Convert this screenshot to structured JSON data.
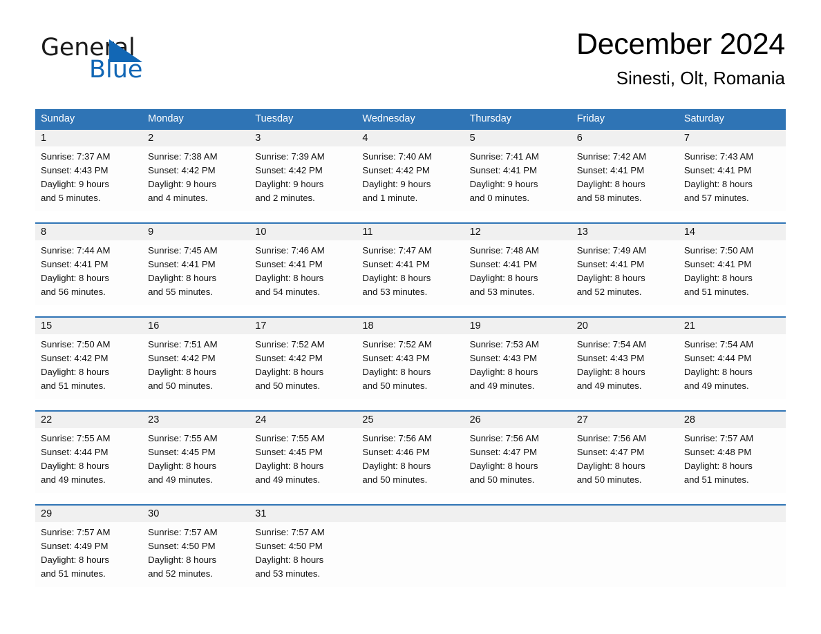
{
  "brand": {
    "name_part1": "General",
    "name_part2": "Blue",
    "triangle_icon": "blue-triangle-logo-icon",
    "accent_color": "#1267b5"
  },
  "header": {
    "month_title": "December 2024",
    "location": "Sinesti, Olt, Romania"
  },
  "calendar": {
    "header_bg_color": "#2f74b5",
    "row_divider_color": "#2f74b5",
    "daynum_band_color": "#f0f0f0",
    "weekday_headers": [
      "Sunday",
      "Monday",
      "Tuesday",
      "Wednesday",
      "Thursday",
      "Friday",
      "Saturday"
    ],
    "weeks": [
      [
        {
          "day": "1",
          "sunrise": "Sunrise: 7:37 AM",
          "sunset": "Sunset: 4:43 PM",
          "daylight_line1": "Daylight: 9 hours",
          "daylight_line2": "and 5 minutes."
        },
        {
          "day": "2",
          "sunrise": "Sunrise: 7:38 AM",
          "sunset": "Sunset: 4:42 PM",
          "daylight_line1": "Daylight: 9 hours",
          "daylight_line2": "and 4 minutes."
        },
        {
          "day": "3",
          "sunrise": "Sunrise: 7:39 AM",
          "sunset": "Sunset: 4:42 PM",
          "daylight_line1": "Daylight: 9 hours",
          "daylight_line2": "and 2 minutes."
        },
        {
          "day": "4",
          "sunrise": "Sunrise: 7:40 AM",
          "sunset": "Sunset: 4:42 PM",
          "daylight_line1": "Daylight: 9 hours",
          "daylight_line2": "and 1 minute."
        },
        {
          "day": "5",
          "sunrise": "Sunrise: 7:41 AM",
          "sunset": "Sunset: 4:41 PM",
          "daylight_line1": "Daylight: 9 hours",
          "daylight_line2": "and 0 minutes."
        },
        {
          "day": "6",
          "sunrise": "Sunrise: 7:42 AM",
          "sunset": "Sunset: 4:41 PM",
          "daylight_line1": "Daylight: 8 hours",
          "daylight_line2": "and 58 minutes."
        },
        {
          "day": "7",
          "sunrise": "Sunrise: 7:43 AM",
          "sunset": "Sunset: 4:41 PM",
          "daylight_line1": "Daylight: 8 hours",
          "daylight_line2": "and 57 minutes."
        }
      ],
      [
        {
          "day": "8",
          "sunrise": "Sunrise: 7:44 AM",
          "sunset": "Sunset: 4:41 PM",
          "daylight_line1": "Daylight: 8 hours",
          "daylight_line2": "and 56 minutes."
        },
        {
          "day": "9",
          "sunrise": "Sunrise: 7:45 AM",
          "sunset": "Sunset: 4:41 PM",
          "daylight_line1": "Daylight: 8 hours",
          "daylight_line2": "and 55 minutes."
        },
        {
          "day": "10",
          "sunrise": "Sunrise: 7:46 AM",
          "sunset": "Sunset: 4:41 PM",
          "daylight_line1": "Daylight: 8 hours",
          "daylight_line2": "and 54 minutes."
        },
        {
          "day": "11",
          "sunrise": "Sunrise: 7:47 AM",
          "sunset": "Sunset: 4:41 PM",
          "daylight_line1": "Daylight: 8 hours",
          "daylight_line2": "and 53 minutes."
        },
        {
          "day": "12",
          "sunrise": "Sunrise: 7:48 AM",
          "sunset": "Sunset: 4:41 PM",
          "daylight_line1": "Daylight: 8 hours",
          "daylight_line2": "and 53 minutes."
        },
        {
          "day": "13",
          "sunrise": "Sunrise: 7:49 AM",
          "sunset": "Sunset: 4:41 PM",
          "daylight_line1": "Daylight: 8 hours",
          "daylight_line2": "and 52 minutes."
        },
        {
          "day": "14",
          "sunrise": "Sunrise: 7:50 AM",
          "sunset": "Sunset: 4:41 PM",
          "daylight_line1": "Daylight: 8 hours",
          "daylight_line2": "and 51 minutes."
        }
      ],
      [
        {
          "day": "15",
          "sunrise": "Sunrise: 7:50 AM",
          "sunset": "Sunset: 4:42 PM",
          "daylight_line1": "Daylight: 8 hours",
          "daylight_line2": "and 51 minutes."
        },
        {
          "day": "16",
          "sunrise": "Sunrise: 7:51 AM",
          "sunset": "Sunset: 4:42 PM",
          "daylight_line1": "Daylight: 8 hours",
          "daylight_line2": "and 50 minutes."
        },
        {
          "day": "17",
          "sunrise": "Sunrise: 7:52 AM",
          "sunset": "Sunset: 4:42 PM",
          "daylight_line1": "Daylight: 8 hours",
          "daylight_line2": "and 50 minutes."
        },
        {
          "day": "18",
          "sunrise": "Sunrise: 7:52 AM",
          "sunset": "Sunset: 4:43 PM",
          "daylight_line1": "Daylight: 8 hours",
          "daylight_line2": "and 50 minutes."
        },
        {
          "day": "19",
          "sunrise": "Sunrise: 7:53 AM",
          "sunset": "Sunset: 4:43 PM",
          "daylight_line1": "Daylight: 8 hours",
          "daylight_line2": "and 49 minutes."
        },
        {
          "day": "20",
          "sunrise": "Sunrise: 7:54 AM",
          "sunset": "Sunset: 4:43 PM",
          "daylight_line1": "Daylight: 8 hours",
          "daylight_line2": "and 49 minutes."
        },
        {
          "day": "21",
          "sunrise": "Sunrise: 7:54 AM",
          "sunset": "Sunset: 4:44 PM",
          "daylight_line1": "Daylight: 8 hours",
          "daylight_line2": "and 49 minutes."
        }
      ],
      [
        {
          "day": "22",
          "sunrise": "Sunrise: 7:55 AM",
          "sunset": "Sunset: 4:44 PM",
          "daylight_line1": "Daylight: 8 hours",
          "daylight_line2": "and 49 minutes."
        },
        {
          "day": "23",
          "sunrise": "Sunrise: 7:55 AM",
          "sunset": "Sunset: 4:45 PM",
          "daylight_line1": "Daylight: 8 hours",
          "daylight_line2": "and 49 minutes."
        },
        {
          "day": "24",
          "sunrise": "Sunrise: 7:55 AM",
          "sunset": "Sunset: 4:45 PM",
          "daylight_line1": "Daylight: 8 hours",
          "daylight_line2": "and 49 minutes."
        },
        {
          "day": "25",
          "sunrise": "Sunrise: 7:56 AM",
          "sunset": "Sunset: 4:46 PM",
          "daylight_line1": "Daylight: 8 hours",
          "daylight_line2": "and 50 minutes."
        },
        {
          "day": "26",
          "sunrise": "Sunrise: 7:56 AM",
          "sunset": "Sunset: 4:47 PM",
          "daylight_line1": "Daylight: 8 hours",
          "daylight_line2": "and 50 minutes."
        },
        {
          "day": "27",
          "sunrise": "Sunrise: 7:56 AM",
          "sunset": "Sunset: 4:47 PM",
          "daylight_line1": "Daylight: 8 hours",
          "daylight_line2": "and 50 minutes."
        },
        {
          "day": "28",
          "sunrise": "Sunrise: 7:57 AM",
          "sunset": "Sunset: 4:48 PM",
          "daylight_line1": "Daylight: 8 hours",
          "daylight_line2": "and 51 minutes."
        }
      ],
      [
        {
          "day": "29",
          "sunrise": "Sunrise: 7:57 AM",
          "sunset": "Sunset: 4:49 PM",
          "daylight_line1": "Daylight: 8 hours",
          "daylight_line2": "and 51 minutes."
        },
        {
          "day": "30",
          "sunrise": "Sunrise: 7:57 AM",
          "sunset": "Sunset: 4:50 PM",
          "daylight_line1": "Daylight: 8 hours",
          "daylight_line2": "and 52 minutes."
        },
        {
          "day": "31",
          "sunrise": "Sunrise: 7:57 AM",
          "sunset": "Sunset: 4:50 PM",
          "daylight_line1": "Daylight: 8 hours",
          "daylight_line2": "and 53 minutes."
        },
        {
          "day": "",
          "sunrise": "",
          "sunset": "",
          "daylight_line1": "",
          "daylight_line2": ""
        },
        {
          "day": "",
          "sunrise": "",
          "sunset": "",
          "daylight_line1": "",
          "daylight_line2": ""
        },
        {
          "day": "",
          "sunrise": "",
          "sunset": "",
          "daylight_line1": "",
          "daylight_line2": ""
        },
        {
          "day": "",
          "sunrise": "",
          "sunset": "",
          "daylight_line1": "",
          "daylight_line2": ""
        }
      ]
    ]
  }
}
